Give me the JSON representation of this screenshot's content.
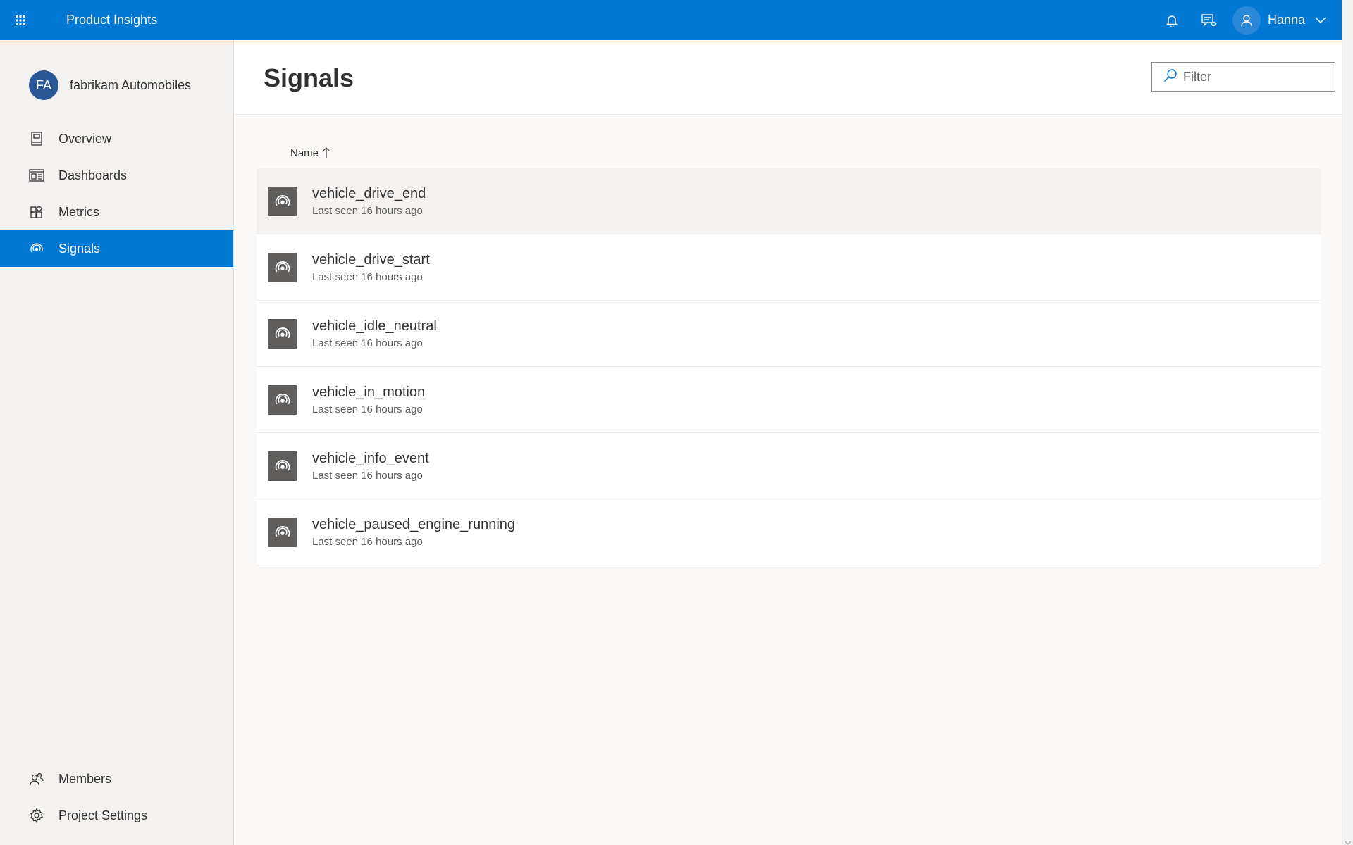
{
  "topbar": {
    "app_title": "Product Insights",
    "user_name": "Hanna",
    "brand_color": "#0078d4"
  },
  "sidebar": {
    "project_initials": "FA",
    "project_name": "fabrikam Automobiles",
    "items": [
      {
        "label": "Overview",
        "icon": "book-icon"
      },
      {
        "label": "Dashboards",
        "icon": "dashboard-icon"
      },
      {
        "label": "Metrics",
        "icon": "metrics-icon"
      },
      {
        "label": "Signals",
        "icon": "signal-icon",
        "active": true
      }
    ],
    "bottom_items": [
      {
        "label": "Members",
        "icon": "members-icon"
      },
      {
        "label": "Project Settings",
        "icon": "gear-icon"
      }
    ]
  },
  "main": {
    "title": "Signals",
    "filter_placeholder": "Filter",
    "column_header": "Name",
    "rows": [
      {
        "name": "vehicle_drive_end",
        "last_seen": "Last seen 16 hours ago"
      },
      {
        "name": "vehicle_drive_start",
        "last_seen": "Last seen 16 hours ago"
      },
      {
        "name": "vehicle_idle_neutral",
        "last_seen": "Last seen 16 hours ago"
      },
      {
        "name": "vehicle_in_motion",
        "last_seen": "Last seen 16 hours ago"
      },
      {
        "name": "vehicle_info_event",
        "last_seen": "Last seen 16 hours ago"
      },
      {
        "name": "vehicle_paused_engine_running",
        "last_seen": "Last seen 16 hours ago"
      }
    ]
  }
}
